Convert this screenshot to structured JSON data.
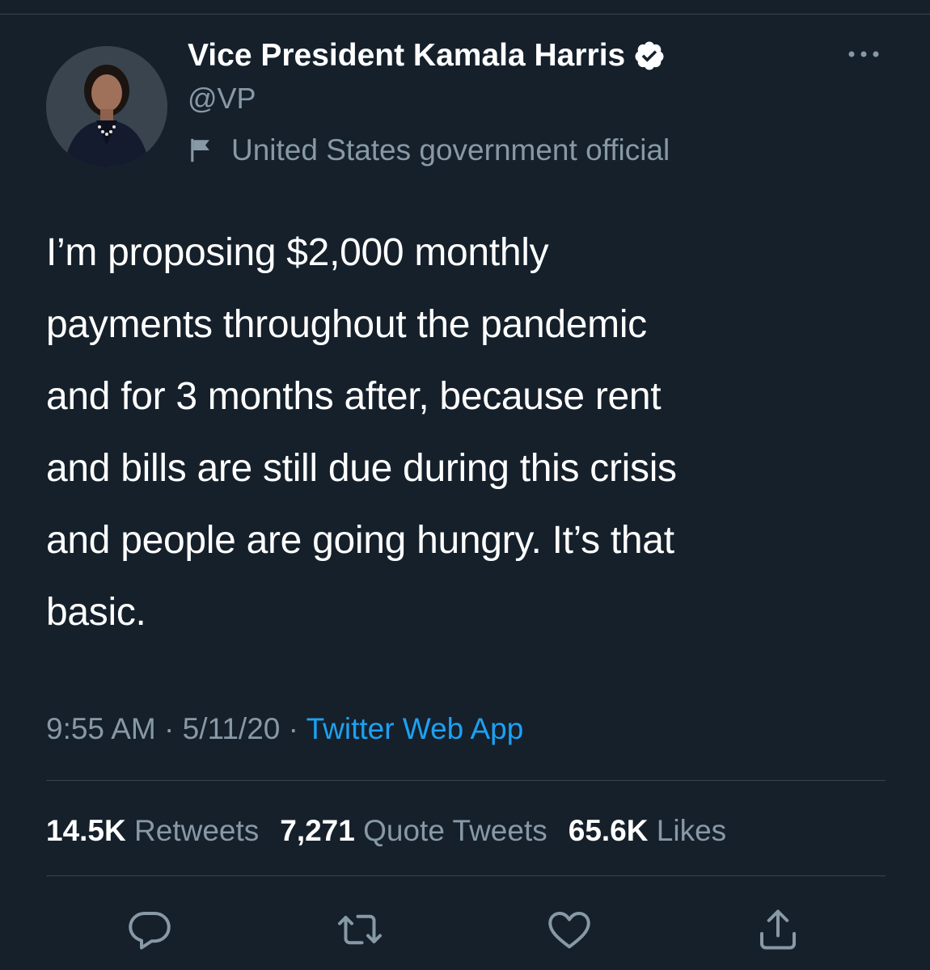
{
  "author": {
    "display_name": "Vice President Kamala Harris",
    "handle": "@VP",
    "label": "United States government official"
  },
  "icons": {
    "verified": "verified-badge-icon",
    "label": "flag-icon",
    "more": "more-options-icon",
    "reply": "reply-icon",
    "retweet": "retweet-icon",
    "like": "like-icon",
    "share": "share-icon"
  },
  "tweet": {
    "text": "I’m proposing $2,000 monthly\npayments throughout the pandemic\nand for 3 months after, because rent\nand bills are still due during this crisis\nand people are going hungry. It’s that\nbasic.",
    "time": "9:55 AM",
    "date": "5/11/20",
    "separator": "·",
    "source": "Twitter Web App"
  },
  "stats": {
    "retweets_count": "14.5K",
    "retweets_label": "Retweets",
    "quotes_count": "7,271",
    "quotes_label": "Quote Tweets",
    "likes_count": "65.6K",
    "likes_label": "Likes"
  },
  "colors": {
    "background": "#15202b",
    "text_primary": "#ffffff",
    "text_secondary": "#8899a6",
    "link": "#1da1f2",
    "divider": "#38444d"
  }
}
